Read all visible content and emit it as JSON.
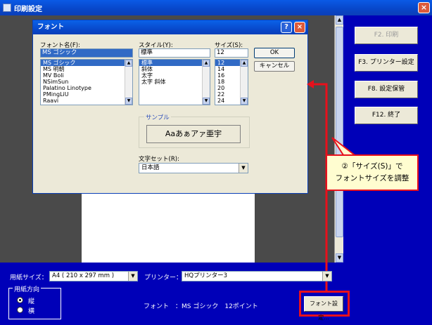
{
  "window": {
    "title": "印刷設定",
    "close_label": "×"
  },
  "dialog": {
    "title": "フォント",
    "help_label": "?",
    "close_label": "×",
    "font_name": {
      "label": "フォント名(F):",
      "value": "MS ゴシック",
      "items": [
        "MS ゴシック",
        "MS 明朝",
        "MV Boli",
        "NSimSun",
        "Palatino Linotype",
        "PMingLiU",
        "Raavi"
      ]
    },
    "style": {
      "label": "スタイル(Y):",
      "value": "標準",
      "items": [
        "標準",
        "斜体",
        "太字",
        "太字 斜体"
      ]
    },
    "size": {
      "label": "サイズ(S):",
      "value": "12",
      "items": [
        "12",
        "14",
        "16",
        "18",
        "20",
        "22",
        "24"
      ]
    },
    "ok_label": "OK",
    "cancel_label": "キャンセル",
    "sample": {
      "label": "サンプル",
      "text": "Aaあぁアァ亜宇"
    },
    "charset": {
      "label": "文字セット(R):",
      "value": "日本語"
    }
  },
  "fkeys": {
    "print": "F2. 印刷",
    "printer_setting": "F3. プリンター設定",
    "save_setting": "F8. 設定保管",
    "exit": "F12. 終了"
  },
  "bottom": {
    "paper_size_label": "用紙サイズ：",
    "paper_size_value": "A4 ( 210 x 297 mm )",
    "printer_label": "プリンター：",
    "printer_value": "HQプリンター3",
    "orientation_label": "用紙方向",
    "portrait_label": "縦",
    "landscape_label": "横",
    "font_label": "フォント　：MS ゴシック　12ポイント",
    "font_setting_button": "フォント設定..."
  },
  "callout": {
    "line1": "②「サイズ(S)」で",
    "line2": "フォントサイズを調整"
  },
  "colors": {
    "accent_red": "#e8101c",
    "window_blue": "#0000b8"
  }
}
